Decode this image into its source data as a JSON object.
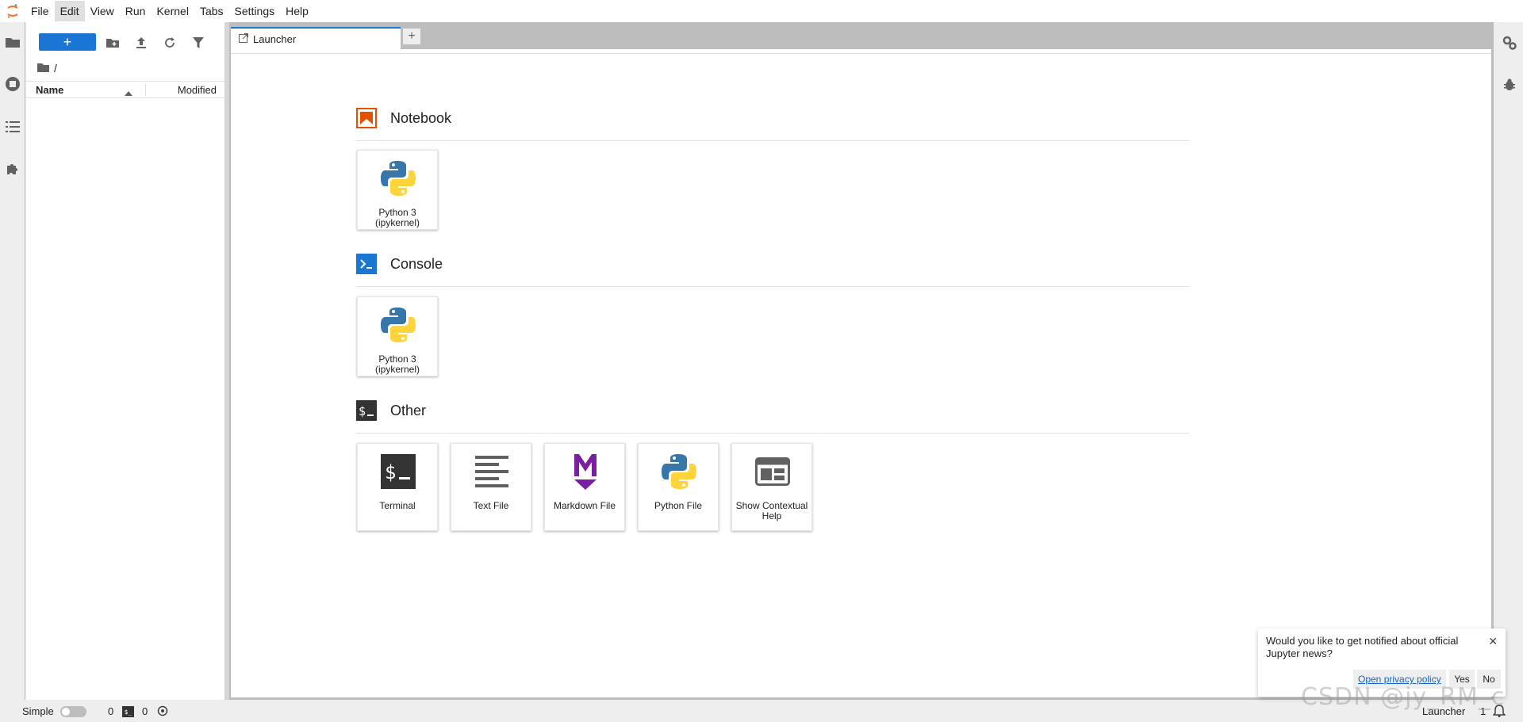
{
  "menu": {
    "items": [
      "File",
      "Edit",
      "View",
      "Run",
      "Kernel",
      "Tabs",
      "Settings",
      "Help"
    ],
    "active_index": 1
  },
  "file_browser": {
    "new_button_label": "+",
    "breadcrumb": "/",
    "columns": {
      "name": "Name",
      "modified": "Modified"
    }
  },
  "tabs": {
    "launcher_label": "Launcher",
    "add_label": "+"
  },
  "launcher": {
    "sections": [
      {
        "title": "Notebook",
        "cards": [
          {
            "label": "Python 3",
            "sub": "(ipykernel)"
          }
        ]
      },
      {
        "title": "Console",
        "cards": [
          {
            "label": "Python 3",
            "sub": "(ipykernel)"
          }
        ]
      },
      {
        "title": "Other",
        "cards": [
          {
            "label": "Terminal"
          },
          {
            "label": "Text File"
          },
          {
            "label": "Markdown File"
          },
          {
            "label": "Python File"
          },
          {
            "label": "Show Contextual Help"
          }
        ]
      }
    ]
  },
  "status": {
    "mode_label": "Simple",
    "terminals_count": "0",
    "kernels_count": "0",
    "current_tab": "Launcher",
    "line": "1"
  },
  "notification": {
    "message": "Would you like to get notified about official Jupyter news?",
    "close": "✕",
    "privacy_link": "Open privacy policy",
    "yes": "Yes",
    "no": "No"
  },
  "watermark": "CSDN @jy_RM_c",
  "colors": {
    "accent": "#1976d2",
    "notebook_orange": "#e65100",
    "markdown_purple": "#7b1fa2"
  }
}
